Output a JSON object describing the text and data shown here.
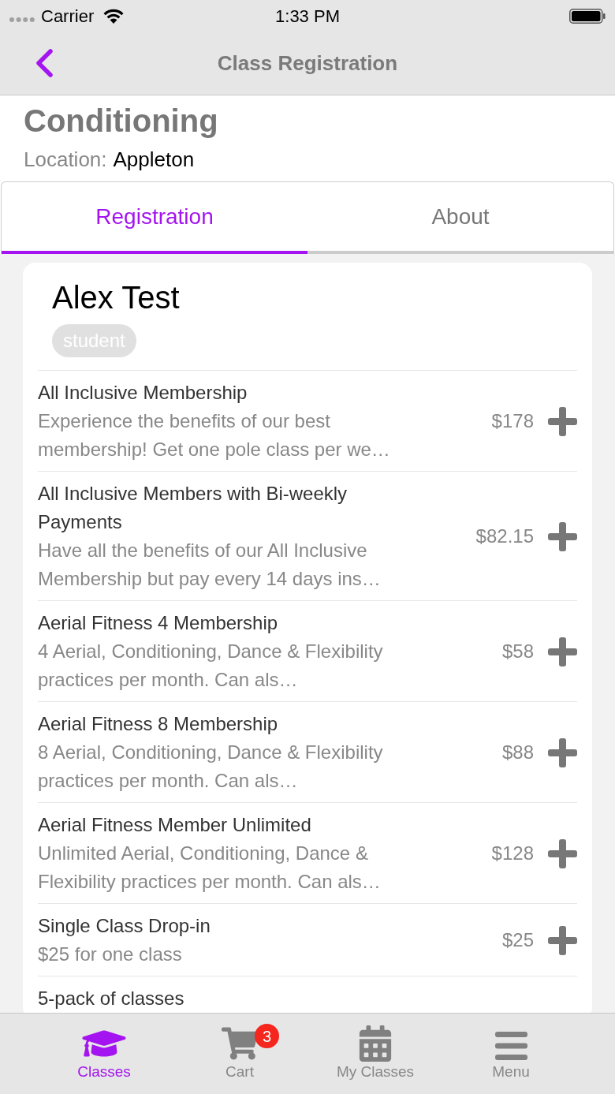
{
  "status_bar": {
    "carrier": "Carrier",
    "time": "1:33 PM"
  },
  "nav": {
    "title": "Class Registration"
  },
  "class": {
    "name": "Conditioning",
    "location_label": "Location:",
    "location": "Appleton"
  },
  "tabs": [
    {
      "label": "Registration",
      "selected": true
    },
    {
      "label": "About",
      "selected": false
    }
  ],
  "student": {
    "name": "Alex Test",
    "role": "student"
  },
  "items": [
    {
      "title": "All Inclusive Membership",
      "description": "Experience the benefits of our best membership! Get one pole class per we…",
      "price": "$178"
    },
    {
      "title": "All Inclusive Members with Bi-weekly Payments",
      "description": "Have all the benefits of our All Inclusive Membership but pay every 14 days ins…",
      "price": "$82.15"
    },
    {
      "title": "Aerial Fitness 4 Membership",
      "description": "4 Aerial, Conditioning, Dance & Flexibility practices per month. Can als…",
      "price": "$58"
    },
    {
      "title": "Aerial Fitness 8 Membership",
      "description": "8 Aerial, Conditioning, Dance & Flexibility practices per month. Can als…",
      "price": "$88"
    },
    {
      "title": "Aerial Fitness Member Unlimited",
      "description": "Unlimited Aerial, Conditioning, Dance & Flexibility practices per month. Can als…",
      "price": "$128"
    },
    {
      "title": "Single Class Drop-in",
      "description": "$25 for one class",
      "price": "$25"
    },
    {
      "title": "5-pack of classes"
    }
  ],
  "bottom_tabs": [
    {
      "kind": "classes",
      "label": "Classes",
      "selected": true
    },
    {
      "kind": "cart",
      "label": "Cart",
      "selected": false,
      "badge": "3"
    },
    {
      "kind": "calendar",
      "label": "My Classes",
      "selected": false
    },
    {
      "kind": "menu",
      "label": "Menu",
      "selected": false
    }
  ]
}
